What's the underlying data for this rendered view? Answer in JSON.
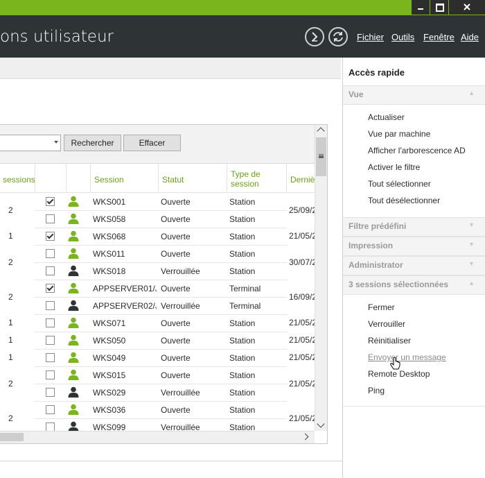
{
  "window": {
    "title": "ons utilisateur",
    "controls": [
      "minimize-icon",
      "maximize-icon",
      "close-icon"
    ],
    "accent_color": "#7ab51d",
    "appbar_color": "#2e3336"
  },
  "menu": {
    "fichier": "Fichier",
    "outils": "Outils",
    "fenetre": "Fenêtre",
    "aide": "Aide"
  },
  "toolbar": {
    "search_placeholder": "",
    "search_button": "Rechercher",
    "clear_button": "Effacer"
  },
  "grid": {
    "headers": {
      "sessions": "sessions",
      "session": "Session",
      "statut": "Statut",
      "type": "Type de session",
      "derniere": "Derniè"
    },
    "rows": [
      {
        "count": "2",
        "checked": true,
        "user_color": "green",
        "session": "WKS001",
        "statut": "Ouverte",
        "type": "Station",
        "date": "25/09/2"
      },
      {
        "count": "",
        "checked": false,
        "user_color": "green",
        "session": "WKS058",
        "statut": "Ouverte",
        "type": "Station",
        "date": ""
      },
      {
        "count": "1",
        "checked": true,
        "user_color": "green",
        "session": "WKS068",
        "statut": "Ouverte",
        "type": "Station",
        "date": "21/05/2"
      },
      {
        "count": "2",
        "checked": false,
        "user_color": "green",
        "session": "WKS011",
        "statut": "Ouverte",
        "type": "Station",
        "date": "30/07/2"
      },
      {
        "count": "",
        "checked": false,
        "user_color": "dark",
        "session": "WKS018",
        "statut": "Verrouillée",
        "type": "Station",
        "date": ""
      },
      {
        "count": "2",
        "checked": true,
        "user_color": "green",
        "session": "APPSERVER01/J...",
        "statut": "Ouverte",
        "type": "Terminal",
        "date": "16/09/2"
      },
      {
        "count": "",
        "checked": false,
        "user_color": "dark",
        "session": "APPSERVER02/J...",
        "statut": "Verrouillée",
        "type": "Terminal",
        "date": ""
      },
      {
        "count": "1",
        "checked": false,
        "user_color": "green",
        "session": "WKS071",
        "statut": "Ouverte",
        "type": "Station",
        "date": "21/05/2"
      },
      {
        "count": "1",
        "checked": false,
        "user_color": "green",
        "session": "WKS050",
        "statut": "Ouverte",
        "type": "Station",
        "date": "21/05/2"
      },
      {
        "count": "1",
        "checked": false,
        "user_color": "green",
        "session": "WKS049",
        "statut": "Ouverte",
        "type": "Station",
        "date": "21/05/2"
      },
      {
        "count": "2",
        "checked": false,
        "user_color": "green",
        "session": "WKS015",
        "statut": "Ouverte",
        "type": "Station",
        "date": "21/05/2"
      },
      {
        "count": "",
        "checked": false,
        "user_color": "dark",
        "session": "WKS029",
        "statut": "Verrouillée",
        "type": "Station",
        "date": ""
      },
      {
        "count": "2",
        "checked": false,
        "user_color": "green",
        "session": "WKS036",
        "statut": "Ouverte",
        "type": "Station",
        "date": "21/05/2"
      },
      {
        "count": "",
        "checked": false,
        "user_color": "dark",
        "session": "WKS099",
        "statut": "Verrouillée",
        "type": "Station",
        "date": ""
      }
    ]
  },
  "quick_access": {
    "title": "Accès rapide",
    "vue_title": "Vue",
    "vue_actions": [
      "Actualiser",
      "Vue par machine",
      "Afficher l'arborescence AD",
      "Activer le filtre",
      "Tout sélectionner",
      "Tout désélectionner"
    ],
    "filtre_title": "Filtre prédéfini",
    "impression_title": "Impression",
    "admin_title": "Administrator",
    "sessions_title": "3 sessions sélectionnées",
    "session_actions": [
      "Fermer",
      "Verrouiller",
      "Réinitialiser",
      "Envoyer un message",
      "Remote Desktop",
      "Ping"
    ]
  }
}
